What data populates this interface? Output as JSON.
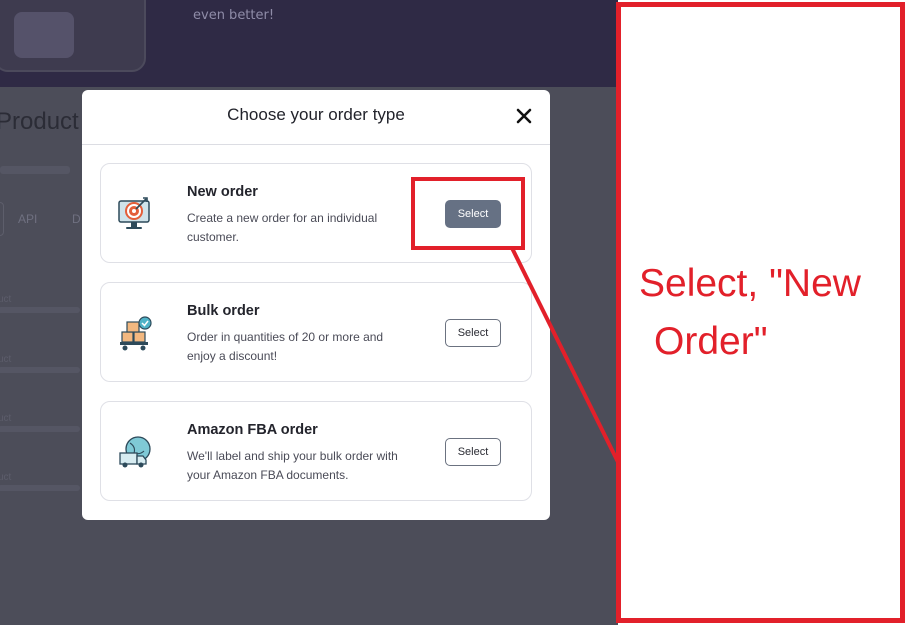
{
  "background": {
    "banner_text": "even better!",
    "page_heading": "Product",
    "tabs": [
      "API",
      "D"
    ],
    "rows": [
      "uct",
      "uct",
      "uct",
      "uct"
    ]
  },
  "modal": {
    "title": "Choose your order type",
    "close_icon": "close-icon",
    "options": [
      {
        "icon": "target-monitor-icon",
        "title": "New order",
        "description": "Create a new order for an individual customer.",
        "button_label": "Select",
        "selected": true
      },
      {
        "icon": "boxes-cart-icon",
        "title": "Bulk order",
        "description": "Order in quantities of 20 or more and enjoy a discount!",
        "button_label": "Select",
        "selected": false
      },
      {
        "icon": "delivery-truck-globe-icon",
        "title": "Amazon FBA order",
        "description": "We'll label and ship your bulk order with your Amazon FBA documents.",
        "button_label": "Select",
        "selected": false
      }
    ]
  },
  "annotation": {
    "line1": "Select, \"New",
    "line2": "Order\"",
    "color": "#e2202a"
  },
  "colors": {
    "selected_button": "#667184",
    "overlay": "#4c4d59",
    "banner": "#2f2a45"
  }
}
